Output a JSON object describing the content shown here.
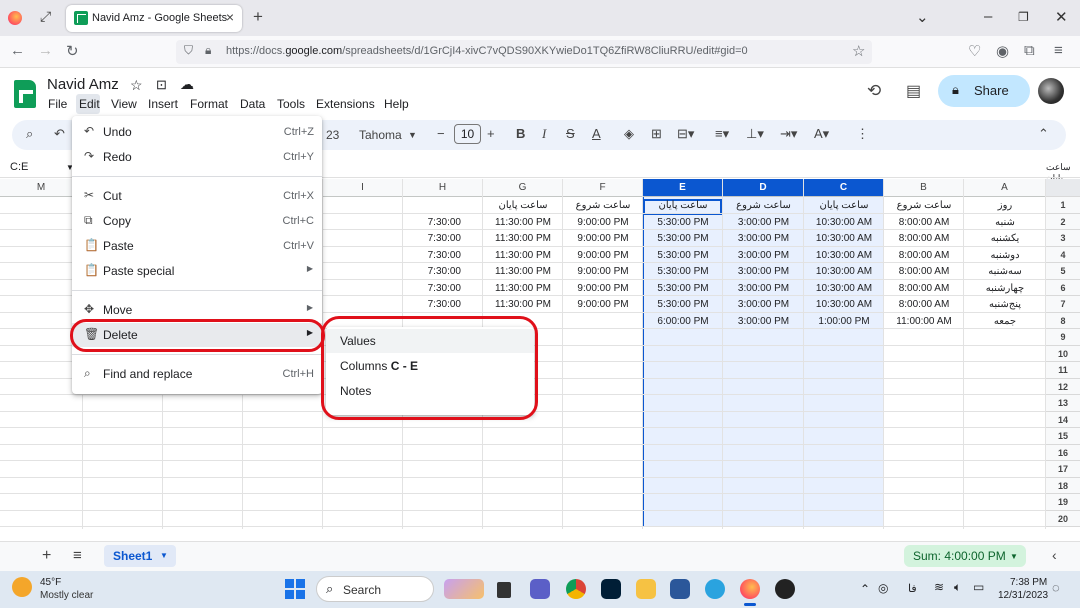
{
  "browser": {
    "tab_title": "Navid Amz - Google Sheets",
    "url_prefix": "https://docs.",
    "url_domain": "google.com",
    "url_rest": "/spreadsheets/d/1GrCjI4-xivC7vQDS90XKYwieDo1TQ6ZfiRW8CliuRRU/edit#gid=0"
  },
  "doc": {
    "name": "Navid Amz",
    "menus": [
      "File",
      "Edit",
      "View",
      "Insert",
      "Format",
      "Data",
      "Tools",
      "Extensions",
      "Help"
    ],
    "share_label": "Share"
  },
  "toolbar": {
    "partial_format": "23",
    "font": "Tahoma",
    "font_size": "10"
  },
  "formula_bar": {
    "name_box": "C:E",
    "content": "ساعت پایان"
  },
  "grid": {
    "columns": [
      "M",
      "",
      "",
      "",
      "I",
      "H",
      "G",
      "F",
      "E",
      "D",
      "C",
      "B",
      "A"
    ],
    "selected_columns": [
      "E",
      "D",
      "C"
    ],
    "row_numbers": [
      "1",
      "2",
      "3",
      "4",
      "5",
      "6",
      "7",
      "8",
      "9",
      "10",
      "11",
      "12",
      "13",
      "14",
      "15",
      "16",
      "17",
      "18",
      "19",
      "20"
    ],
    "rows": [
      {
        "H": "",
        "G": "ساعت پایان",
        "F": "ساعت شروع",
        "E": "ساعت پایان",
        "D": "ساعت شروع",
        "C": "ساعت پایان",
        "B": "ساعت شروع",
        "A": "روز"
      },
      {
        "H": "7:30:00",
        "G": "11:30:00 PM",
        "F": "9:00:00 PM",
        "E": "5:30:00 PM",
        "D": "3:00:00 PM",
        "C": "10:30:00 AM",
        "B": "8:00:00 AM",
        "A": "شنبه"
      },
      {
        "H": "7:30:00",
        "G": "11:30:00 PM",
        "F": "9:00:00 PM",
        "E": "5:30:00 PM",
        "D": "3:00:00 PM",
        "C": "10:30:00 AM",
        "B": "8:00:00 AM",
        "A": "یکشنبه"
      },
      {
        "H": "7:30:00",
        "G": "11:30:00 PM",
        "F": "9:00:00 PM",
        "E": "5:30:00 PM",
        "D": "3:00:00 PM",
        "C": "10:30:00 AM",
        "B": "8:00:00 AM",
        "A": "دوشنبه"
      },
      {
        "H": "7:30:00",
        "G": "11:30:00 PM",
        "F": "9:00:00 PM",
        "E": "5:30:00 PM",
        "D": "3:00:00 PM",
        "C": "10:30:00 AM",
        "B": "8:00:00 AM",
        "A": "سه‌شنبه"
      },
      {
        "H": "7:30:00",
        "G": "11:30:00 PM",
        "F": "9:00:00 PM",
        "E": "5:30:00 PM",
        "D": "3:00:00 PM",
        "C": "10:30:00 AM",
        "B": "8:00:00 AM",
        "A": "چهارشنبه"
      },
      {
        "H": "7:30:00",
        "G": "11:30:00 PM",
        "F": "9:00:00 PM",
        "E": "5:30:00 PM",
        "D": "3:00:00 PM",
        "C": "10:30:00 AM",
        "B": "8:00:00 AM",
        "A": "پنج‌شنبه"
      },
      {
        "H": "",
        "G": "",
        "F": "",
        "E": "6:00:00 PM",
        "D": "3:00:00 PM",
        "C": "1:00:00 PM",
        "B": "11:00:00 AM",
        "A": "جمعه"
      }
    ]
  },
  "edit_menu": {
    "items": [
      {
        "icon": "undo-icon",
        "glyph": "↶",
        "label": "Undo",
        "shortcut": "Ctrl+Z"
      },
      {
        "icon": "redo-icon",
        "glyph": "↷",
        "label": "Redo",
        "shortcut": "Ctrl+Y"
      },
      {
        "icon": "cut-icon",
        "glyph": "✂",
        "label": "Cut",
        "shortcut": "Ctrl+X"
      },
      {
        "icon": "copy-icon",
        "glyph": "⧉",
        "label": "Copy",
        "shortcut": "Ctrl+C"
      },
      {
        "icon": "paste-icon",
        "glyph": "📋",
        "label": "Paste",
        "shortcut": "Ctrl+V"
      },
      {
        "icon": "paste-special-icon",
        "glyph": "📋",
        "label": "Paste special",
        "shortcut": ""
      },
      {
        "icon": "move-icon",
        "glyph": "✥",
        "label": "Move",
        "shortcut": ""
      },
      {
        "icon": "trash-icon",
        "glyph": "🗑",
        "label": "Delete",
        "shortcut": ""
      },
      {
        "icon": "find-replace-icon",
        "glyph": "⌕",
        "label": "Find and replace",
        "shortcut": "Ctrl+H"
      }
    ]
  },
  "delete_submenu": {
    "values": "Values",
    "columns_prefix": "Columns",
    "columns_range": "C - E",
    "notes": "Notes"
  },
  "sheets_bar": {
    "sheet_name": "Sheet1",
    "sum": "Sum: 4:00:00 PM"
  },
  "taskbar": {
    "temperature": "45°F",
    "weather": "Mostly clear",
    "search_label": "Search",
    "language": "فا",
    "time": "7:38 PM",
    "date": "12/31/2023"
  },
  "colors": {
    "accent": "#0b57d0",
    "highlight": "#e0101a",
    "share_bg": "#c2e7ff",
    "sheets_green": "#0f9d58"
  }
}
